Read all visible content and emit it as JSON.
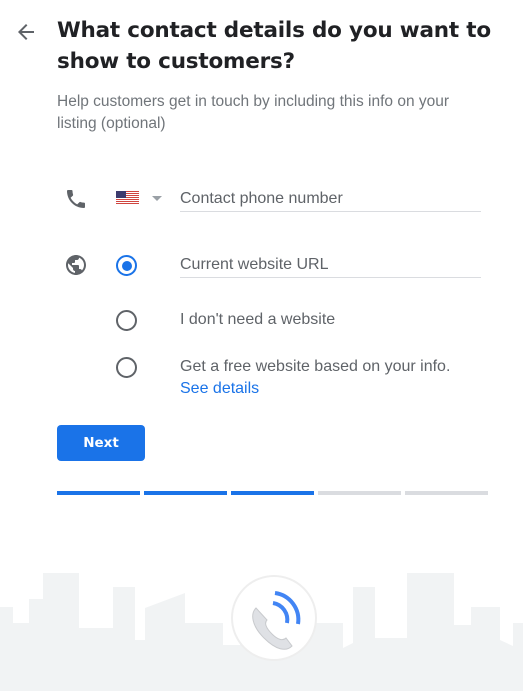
{
  "header": {
    "back_icon": "arrow-back-icon",
    "title": "What contact details do you want to show to customers?",
    "subtitle": "Help customers get in touch by including this info on your listing (optional)"
  },
  "phone": {
    "icon": "phone-icon",
    "country": "United States",
    "country_flag_icon": "us-flag-icon",
    "placeholder": "Contact phone number",
    "value": ""
  },
  "website": {
    "icon": "globe-icon",
    "options": [
      {
        "type": "input",
        "placeholder": "Current website URL",
        "value": "",
        "selected": true
      },
      {
        "label": "I don't need a website",
        "selected": false
      },
      {
        "label": "Get a free website based on your info.",
        "link": "See details",
        "selected": false
      }
    ]
  },
  "actions": {
    "next_label": "Next"
  },
  "progress": {
    "total_steps": 5,
    "completed_steps": 3
  },
  "illustration": {
    "icon": "phone-call-illustration",
    "accent_color": "#4285f4"
  },
  "colors": {
    "primary": "#1a73e8",
    "text": "#202124",
    "secondary_text": "#5f6368"
  }
}
